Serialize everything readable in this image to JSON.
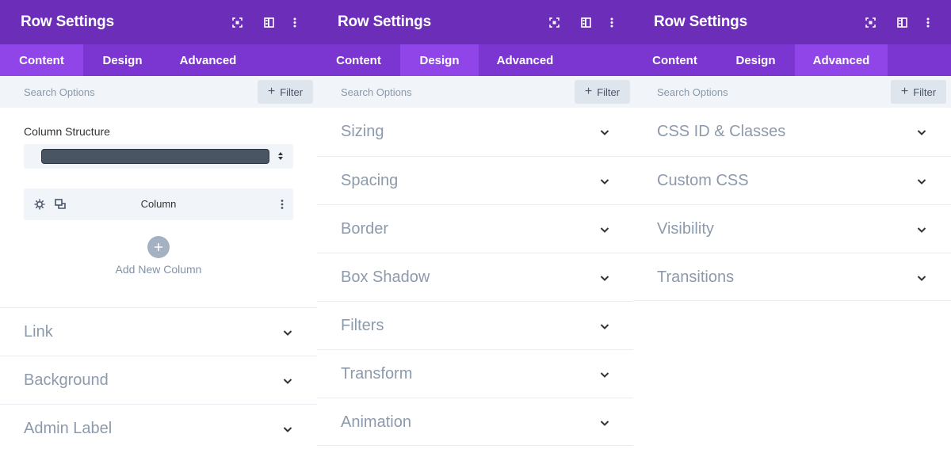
{
  "panels": [
    {
      "title": "Row Settings",
      "tabs": [
        "Content",
        "Design",
        "Advanced"
      ],
      "active_tab": "Content",
      "search": {
        "placeholder": "Search Options"
      },
      "filter_label": "Filter",
      "column_structure_label": "Column Structure",
      "column_label": "Column",
      "add_column_label": "Add New Column",
      "sections": [
        "Link",
        "Background",
        "Admin Label"
      ]
    },
    {
      "title": "Row Settings",
      "tabs": [
        "Content",
        "Design",
        "Advanced"
      ],
      "active_tab": "Design",
      "search": {
        "placeholder": "Search Options"
      },
      "filter_label": "Filter",
      "sections": [
        "Sizing",
        "Spacing",
        "Border",
        "Box Shadow",
        "Filters",
        "Transform",
        "Animation"
      ]
    },
    {
      "title": "Row Settings",
      "tabs": [
        "Content",
        "Design",
        "Advanced"
      ],
      "active_tab": "Advanced",
      "search": {
        "placeholder": "Search Options"
      },
      "filter_label": "Filter",
      "sections": [
        "CSS ID & Classes",
        "Custom CSS",
        "Visibility",
        "Transitions"
      ]
    }
  ],
  "icons": {
    "header": [
      "fullscreen-icon",
      "split-view-icon",
      "more-vertical-icon"
    ],
    "column_item": [
      "gear-icon",
      "duplicate-icon",
      "more-vertical-icon"
    ],
    "section": "chevron-down-icon",
    "add": "plus-icon"
  },
  "colors": {
    "header_bg": "#6c2eb9",
    "tabs_bg": "#7b35d1",
    "active_tab_bg": "#8f45e8",
    "search_bg": "#f1f5f9",
    "section_text": "#8c9aab"
  }
}
